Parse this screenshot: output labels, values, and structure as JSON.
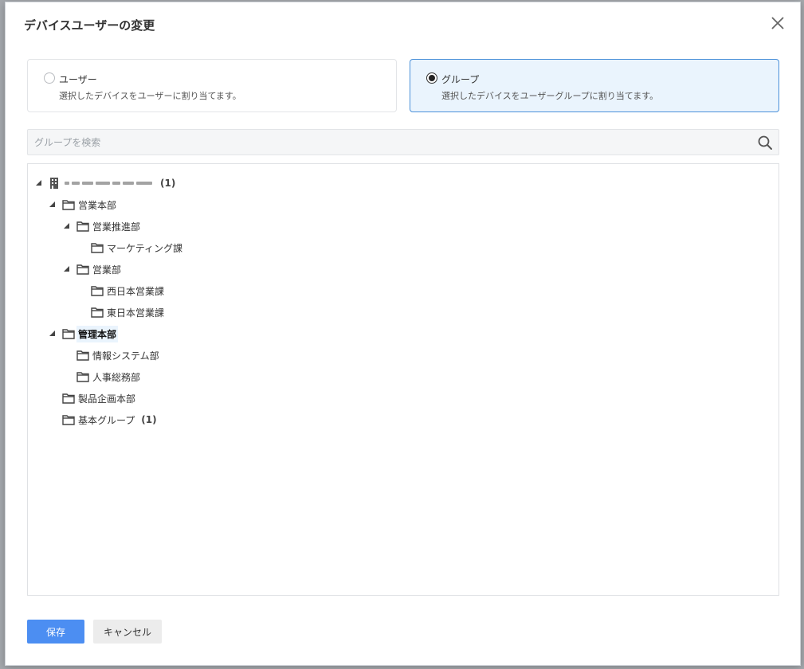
{
  "dialog": {
    "title": "デバイスユーザーの変更"
  },
  "options": {
    "user": {
      "label": "ユーザー",
      "description": "選択したデバイスをユーザーに割り当てます。",
      "selected": false
    },
    "group": {
      "label": "グループ",
      "description": "選択したデバイスをユーザーグループに割り当てます。",
      "selected": true
    }
  },
  "search": {
    "placeholder": "グループを検索",
    "value": ""
  },
  "tree": {
    "root": {
      "label": "",
      "count": "(1)",
      "icon": "building-icon"
    },
    "nodes": [
      {
        "label": "営業本部",
        "icon": "folder-icon",
        "expanded": true
      },
      {
        "label": "営業推進部",
        "icon": "folder-icon",
        "expanded": true
      },
      {
        "label": "マーケティング課",
        "icon": "folder-icon"
      },
      {
        "label": "営業部",
        "icon": "folder-icon",
        "expanded": true
      },
      {
        "label": "西日本営業課",
        "icon": "folder-icon"
      },
      {
        "label": "東日本営業課",
        "icon": "folder-icon"
      },
      {
        "label": "管理本部",
        "icon": "folder-icon",
        "expanded": true,
        "selected": true
      },
      {
        "label": "情報システム部",
        "icon": "folder-icon"
      },
      {
        "label": "人事総務部",
        "icon": "folder-icon"
      },
      {
        "label": "製品企画本部",
        "icon": "folder-icon"
      },
      {
        "label": "基本グループ",
        "icon": "folder-icon",
        "count": "(1)"
      }
    ]
  },
  "footer": {
    "save_label": "保存",
    "cancel_label": "キャンセル"
  },
  "colors": {
    "accent": "#4c8ef2",
    "selected_card_bg": "#eaf4fd",
    "selected_card_border": "#4a90d9"
  }
}
